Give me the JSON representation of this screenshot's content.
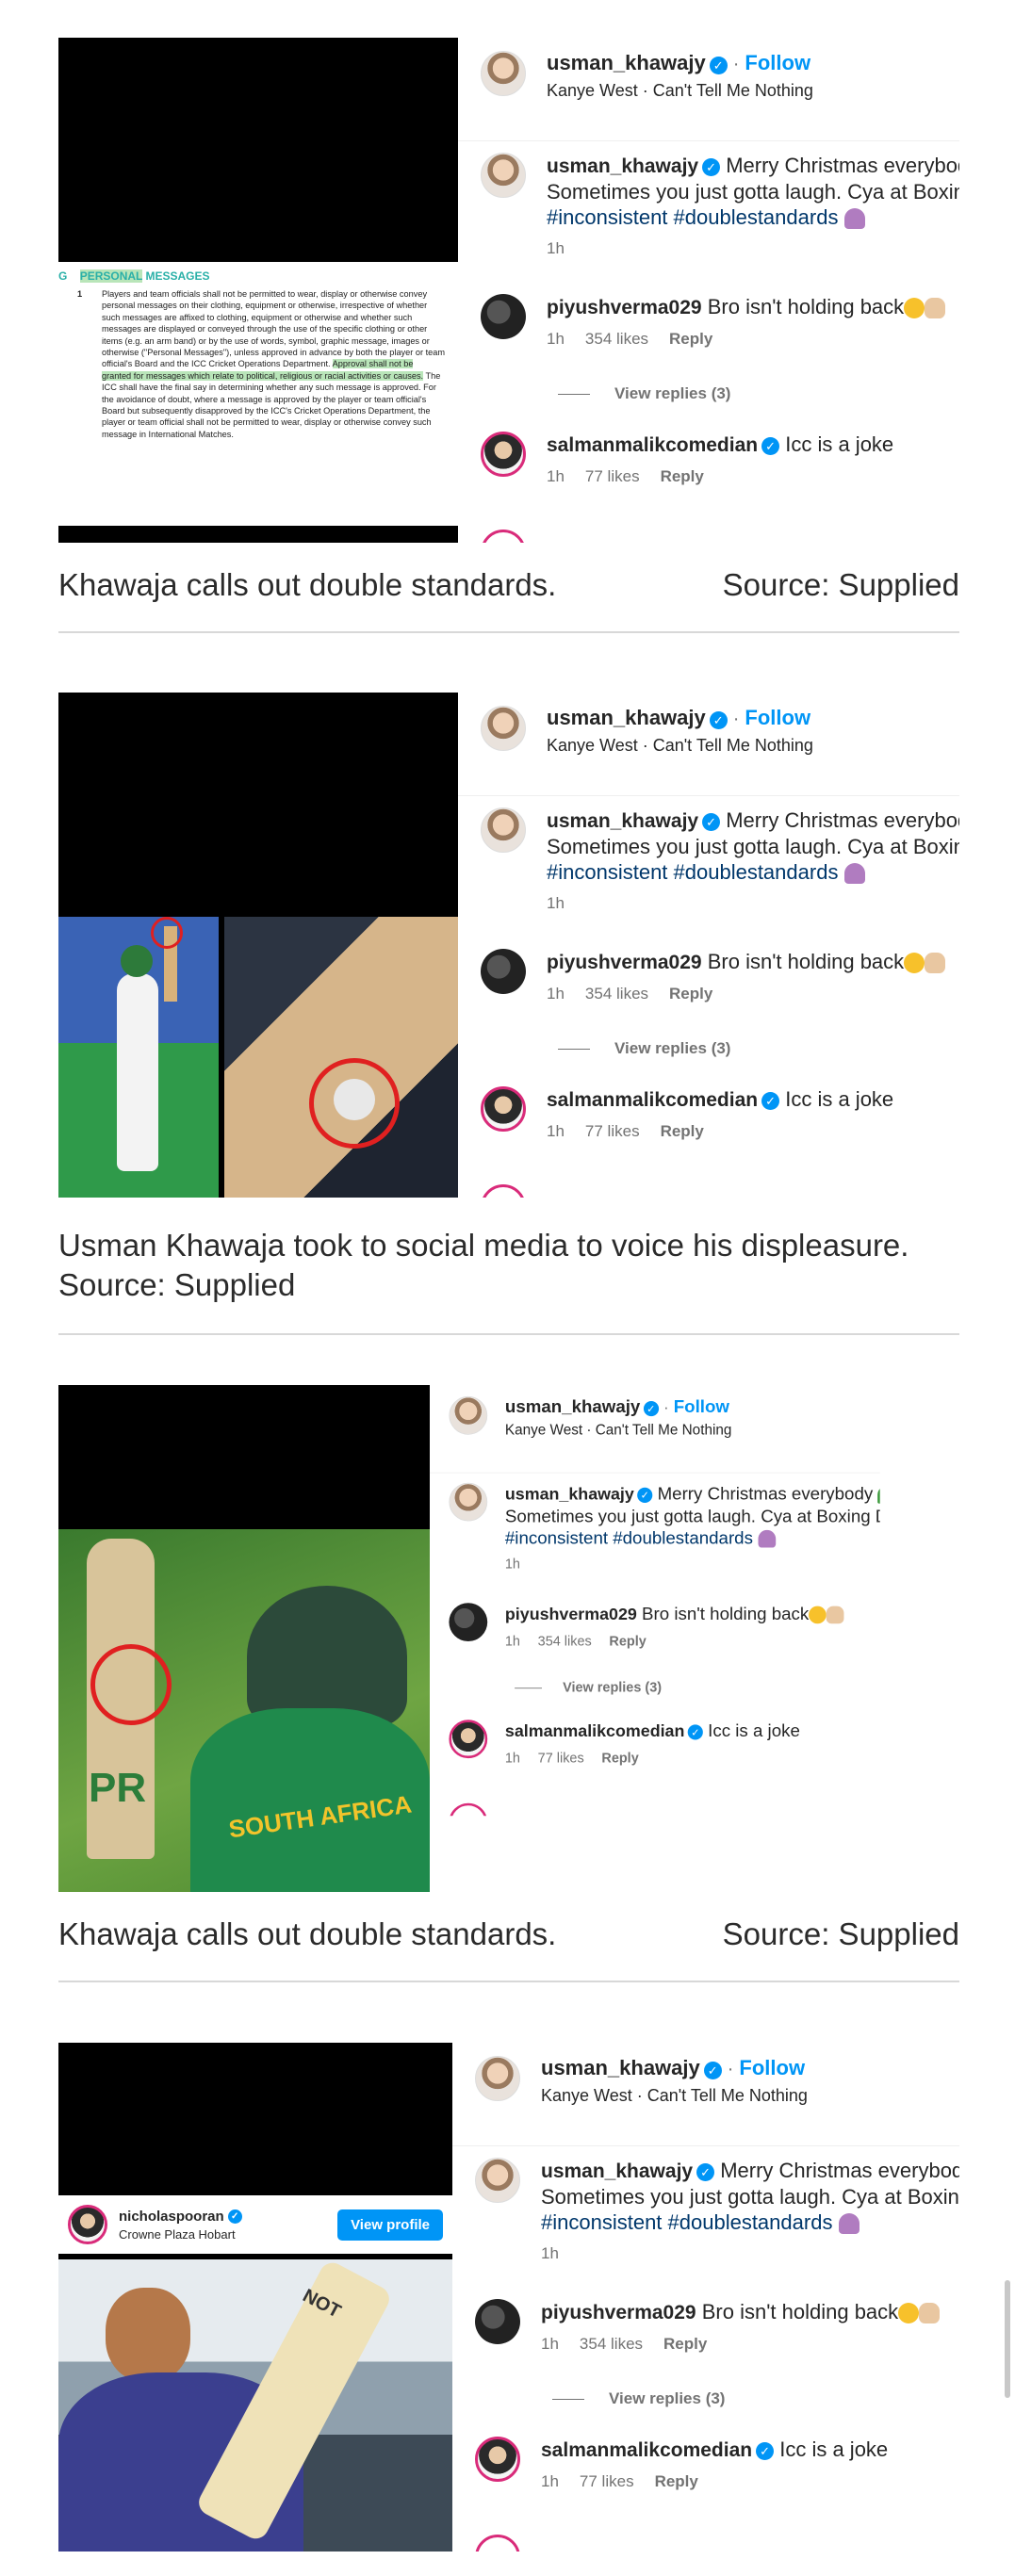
{
  "post": {
    "username": "usman_khawajy",
    "follow_label": "Follow",
    "audio": "Kanye West · Can't Tell Me Nothing",
    "caption_line1": "Merry Christmas everybody",
    "caption_line2": "Sometimes you just gotta laugh. Cya at Boxing Day!",
    "hashtags": "#inconsistent #doublestandards",
    "caption_time": "1h",
    "comments": [
      {
        "username": "piyushverma029",
        "text": "Bro isn't holding back",
        "time": "1h",
        "likes": "354 likes",
        "reply": "Reply"
      },
      {
        "username": "salmanmalikcomedian",
        "text": "Icc is a joke",
        "time": "1h",
        "likes": "77 likes",
        "reply": "Reply"
      }
    ],
    "view_replies": "View replies (3)"
  },
  "regulation": {
    "section_prefix": "G",
    "heading_highlight": "PERSONAL",
    "heading_rest": "MESSAGES",
    "number": "1",
    "text_pre": "Players and team officials shall not be permitted to wear, display or otherwise convey personal messages on their clothing, equipment or otherwise, irrespective of whether such messages are affixed to clothing, equipment or otherwise and whether such messages are displayed or conveyed through the use of the specific clothing or other items (e.g. an arm band) or by the use of words, symbol, graphic message, images or otherwise (\"Personal Messages\"), unless approved in advance by both the player or team official's Board and the ICC Cricket Operations Department.",
    "text_highlight": "Approval shall not be granted for messages which relate to political, religious or racial activities or causes.",
    "text_post": "The ICC shall have the final say in determining whether any such message is approved. For the avoidance of doubt, where a message is approved by the player or team official's Board but subsequently disapproved by the ICC's Cricket Operations Department, the player or team official shall not be permitted to wear, display or otherwise convey such message in International Matches."
  },
  "captions": {
    "c1_left": "Khawaja calls out double standards.",
    "c1_right": "Source: Supplied",
    "c2": "Usman Khawaja took to social media to voice his displeasure. Source: Supplied",
    "c3_left": "Khawaja calls out double standards.",
    "c3_right": "Source: Supplied"
  },
  "photo3": {
    "shirt_text": "SOUTH AFRICA",
    "bat_text": "PR"
  },
  "photo4": {
    "username": "nicholaspooran",
    "location": "Crowne Plaza Hobart",
    "view_profile": "View profile",
    "bat_text": "NOT"
  },
  "icons": [
    "heart-icon",
    "comment-icon",
    "share-icon"
  ],
  "colors": {
    "accent": "#0095f6",
    "story_ring": "#d92b7a",
    "highlight_green": "#b9e5b9",
    "regulation_heading": "#2ab0a8"
  }
}
